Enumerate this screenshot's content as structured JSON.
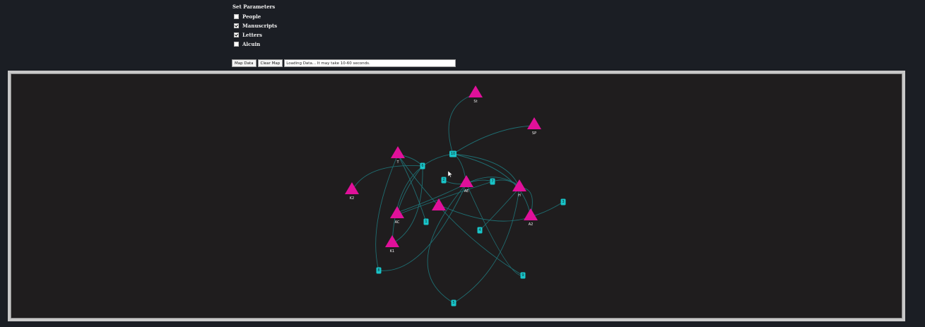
{
  "parameters": {
    "title": "Set Parameters",
    "options": [
      {
        "label": "People",
        "checked": false
      },
      {
        "label": "Manuscripts",
        "checked": true
      },
      {
        "label": "Letters",
        "checked": true
      },
      {
        "label": "Alcuin",
        "checked": false
      }
    ]
  },
  "controls": {
    "map_button": "Map Data",
    "clear_button": "Clear Map",
    "status_text": "Loading Data... It may take 10-60 seconds."
  },
  "colors": {
    "node": "#e0109a",
    "edge": "#1f6e72",
    "badge": "#19c4c8",
    "frame_bg": "#1f1d1e"
  },
  "map": {
    "nodes": [
      {
        "id": "St",
        "label": "St"
      },
      {
        "id": "SP",
        "label": "SP"
      },
      {
        "id": "T",
        "label": "T"
      },
      {
        "id": "AE",
        "label": "AE"
      },
      {
        "id": "H",
        "label": "H"
      },
      {
        "id": "K2",
        "label": "K2"
      },
      {
        "id": "AC",
        "label": "AC"
      },
      {
        "id": "N",
        "label": ""
      },
      {
        "id": "A2",
        "label": "A2"
      },
      {
        "id": "K1",
        "label": "K1"
      }
    ],
    "badges": [
      {
        "id": "b10",
        "label": "10"
      },
      {
        "id": "b6",
        "label": "6"
      },
      {
        "id": "b2",
        "label": "2"
      },
      {
        "id": "b7",
        "label": "7"
      },
      {
        "id": "b3",
        "label": "3"
      },
      {
        "id": "b1",
        "label": "1"
      },
      {
        "id": "b4",
        "label": "4"
      },
      {
        "id": "b8",
        "label": "8"
      },
      {
        "id": "b9",
        "label": "9"
      },
      {
        "id": "b5",
        "label": "5"
      }
    ]
  }
}
